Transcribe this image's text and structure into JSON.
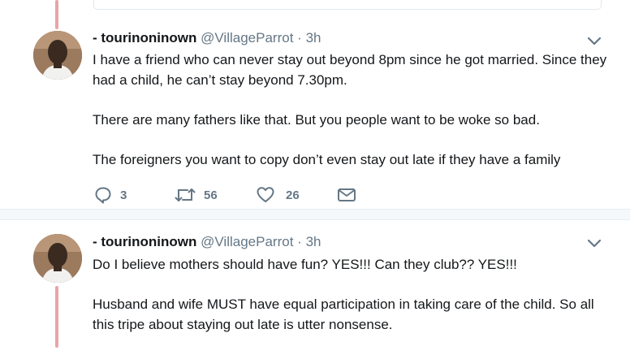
{
  "tweets": [
    {
      "display_name": "- tourinoninown",
      "handle": "@VillageParrot",
      "separator": "·",
      "time": "3h",
      "paragraphs": [
        "I have a friend who can never stay out beyond 8pm since he got married. Since they had a child, he can’t stay beyond 7.30pm.",
        "There are many fathers like that. But you people want to be woke so bad.",
        "The foreigners you want to copy don’t even stay out late if they have a family"
      ],
      "replies": "3",
      "retweets": "56",
      "likes": "26",
      "icons": [
        "chevron-down-icon",
        "reply-icon",
        "retweet-icon",
        "heart-icon",
        "envelope-icon"
      ]
    },
    {
      "display_name": "- tourinoninown",
      "handle": "@VillageParrot",
      "separator": "·",
      "time": "3h",
      "paragraphs": [
        "Do I believe mothers should have fun? YES!!! Can they club?? YES!!!",
        "Husband and wife MUST have equal participation in taking care of the child. So all this tripe about staying out late is utter nonsense."
      ],
      "icons": [
        "chevron-down-icon"
      ]
    }
  ],
  "colors": {
    "thread_line": "#e8a4a9",
    "text": "#14171a",
    "muted": "#657786",
    "divider": "#f5f8fa"
  }
}
